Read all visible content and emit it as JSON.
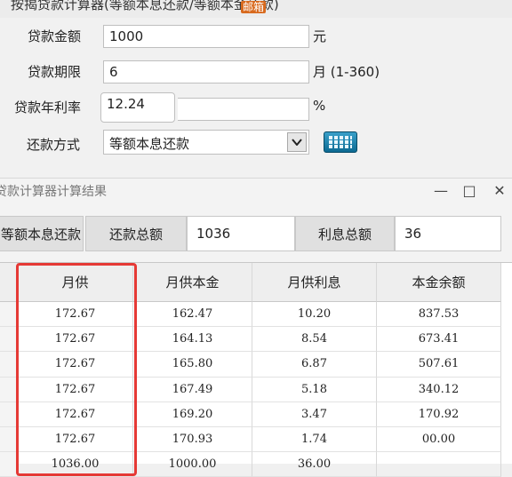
{
  "header": {
    "title": "按揭贷款计算器(等额本息还款/等额本金还款)",
    "watermark": "邮箱"
  },
  "form": {
    "amount": {
      "label": "贷款金额",
      "value": "1000",
      "unit": "元"
    },
    "term": {
      "label": "贷款期限",
      "value": "6",
      "unit": "月 (1-360)"
    },
    "rate": {
      "label": "贷款年利率",
      "value": "12.24",
      "unit": "%"
    },
    "method": {
      "label": "还款方式",
      "selected": "等额本息还款"
    },
    "calc_icon": "calculator-icon"
  },
  "result_window": {
    "title": "贷款计算器计算结果",
    "controls": {
      "minimize": "—",
      "maximize": "□",
      "close": "✕"
    },
    "summary": {
      "method": "等额本息还款",
      "total_label": "还款总额",
      "total_value": "1036",
      "interest_label": "利息总额",
      "interest_value": "36"
    },
    "table": {
      "columns": [
        "月供",
        "月供本金",
        "月供利息",
        "本金余额"
      ],
      "rows": [
        [
          "172.67",
          "162.47",
          "10.20",
          "837.53"
        ],
        [
          "172.67",
          "164.13",
          "8.54",
          "673.41"
        ],
        [
          "172.67",
          "165.80",
          "6.87",
          "507.61"
        ],
        [
          "172.67",
          "167.49",
          "5.18",
          "340.12"
        ],
        [
          "172.67",
          "169.20",
          "3.47",
          "170.92"
        ],
        [
          "172.67",
          "170.93",
          "1.74",
          "00.00"
        ],
        [
          "1036.00",
          "1000.00",
          "36.00",
          ""
        ]
      ]
    }
  },
  "colors": {
    "highlight": "#e53935",
    "accent": "#0d6a92"
  }
}
